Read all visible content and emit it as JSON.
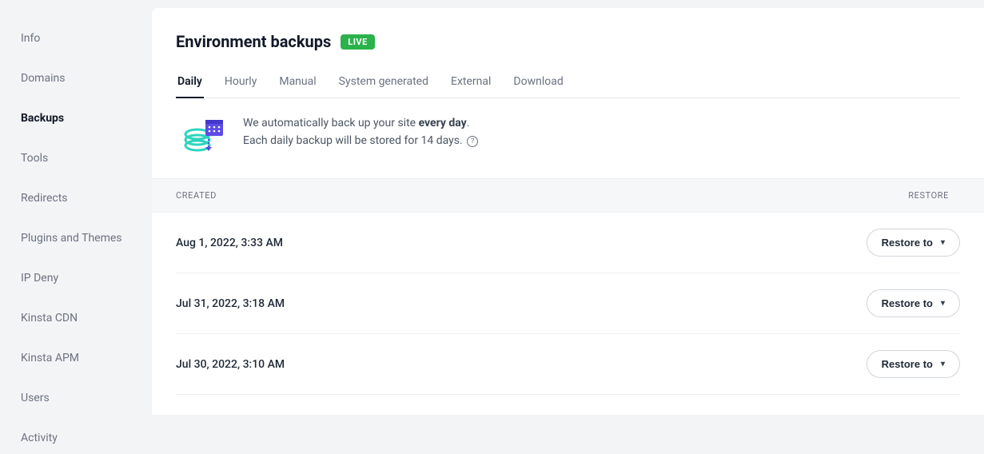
{
  "sidebar": {
    "items": [
      {
        "label": "Info",
        "active": false
      },
      {
        "label": "Domains",
        "active": false
      },
      {
        "label": "Backups",
        "active": true
      },
      {
        "label": "Tools",
        "active": false
      },
      {
        "label": "Redirects",
        "active": false
      },
      {
        "label": "Plugins and Themes",
        "active": false
      },
      {
        "label": "IP Deny",
        "active": false
      },
      {
        "label": "Kinsta CDN",
        "active": false
      },
      {
        "label": "Kinsta APM",
        "active": false
      },
      {
        "label": "Users",
        "active": false
      },
      {
        "label": "Activity",
        "active": false
      }
    ]
  },
  "header": {
    "title": "Environment backups",
    "badge": "LIVE"
  },
  "tabs": [
    {
      "label": "Daily",
      "active": true
    },
    {
      "label": "Hourly",
      "active": false
    },
    {
      "label": "Manual",
      "active": false
    },
    {
      "label": "System generated",
      "active": false
    },
    {
      "label": "External",
      "active": false
    },
    {
      "label": "Download",
      "active": false
    }
  ],
  "banner": {
    "line1_prefix": "We automatically back up your site ",
    "line1_bold": "every day",
    "line1_suffix": ".",
    "line2": "Each daily backup will be stored for 14 days."
  },
  "table": {
    "col_created": "CREATED",
    "col_restore": "RESTORE",
    "restore_label": "Restore to",
    "rows": [
      {
        "created": "Aug 1, 2022, 3:33 AM"
      },
      {
        "created": "Jul 31, 2022, 3:18 AM"
      },
      {
        "created": "Jul 30, 2022, 3:10 AM"
      }
    ]
  }
}
